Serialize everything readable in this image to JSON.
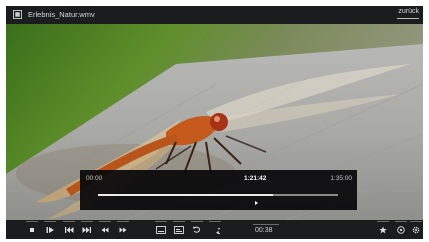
{
  "window": {
    "title": "Erlebnis_Natur.wmv",
    "back_label": "zurück"
  },
  "seekbar": {
    "start_time": "00:00",
    "current_time": "1:21:42",
    "end_time": "1:35:00",
    "progress": 0.73
  },
  "controls": {
    "time": "00:38",
    "buttons": [
      {
        "name": "stop-button",
        "icon": "stop-icon"
      },
      {
        "name": "play-pause-button",
        "icon": "play-pause-icon"
      },
      {
        "name": "previous-chapter-button",
        "icon": "skip-back-icon"
      },
      {
        "name": "next-chapter-button",
        "icon": "skip-forward-icon"
      },
      {
        "name": "rewind-button",
        "icon": "rewind-icon"
      },
      {
        "name": "fast-forward-button",
        "icon": "fast-forward-icon"
      },
      {
        "name": "subtitles-button",
        "icon": "subtitles-icon"
      },
      {
        "name": "audio-track-button",
        "icon": "audio-track-icon"
      },
      {
        "name": "repeat-button",
        "icon": "repeat-icon"
      },
      {
        "name": "repeat-ab-button",
        "icon": "repeat-ab-icon"
      },
      {
        "name": "favorite-button",
        "icon": "star-icon"
      },
      {
        "name": "info-button",
        "icon": "info-icon"
      },
      {
        "name": "settings-button",
        "icon": "gear-icon"
      }
    ]
  },
  "colors": {
    "background": "#17181a",
    "bar": "#1b1c1e",
    "text": "#d8d8d8"
  }
}
